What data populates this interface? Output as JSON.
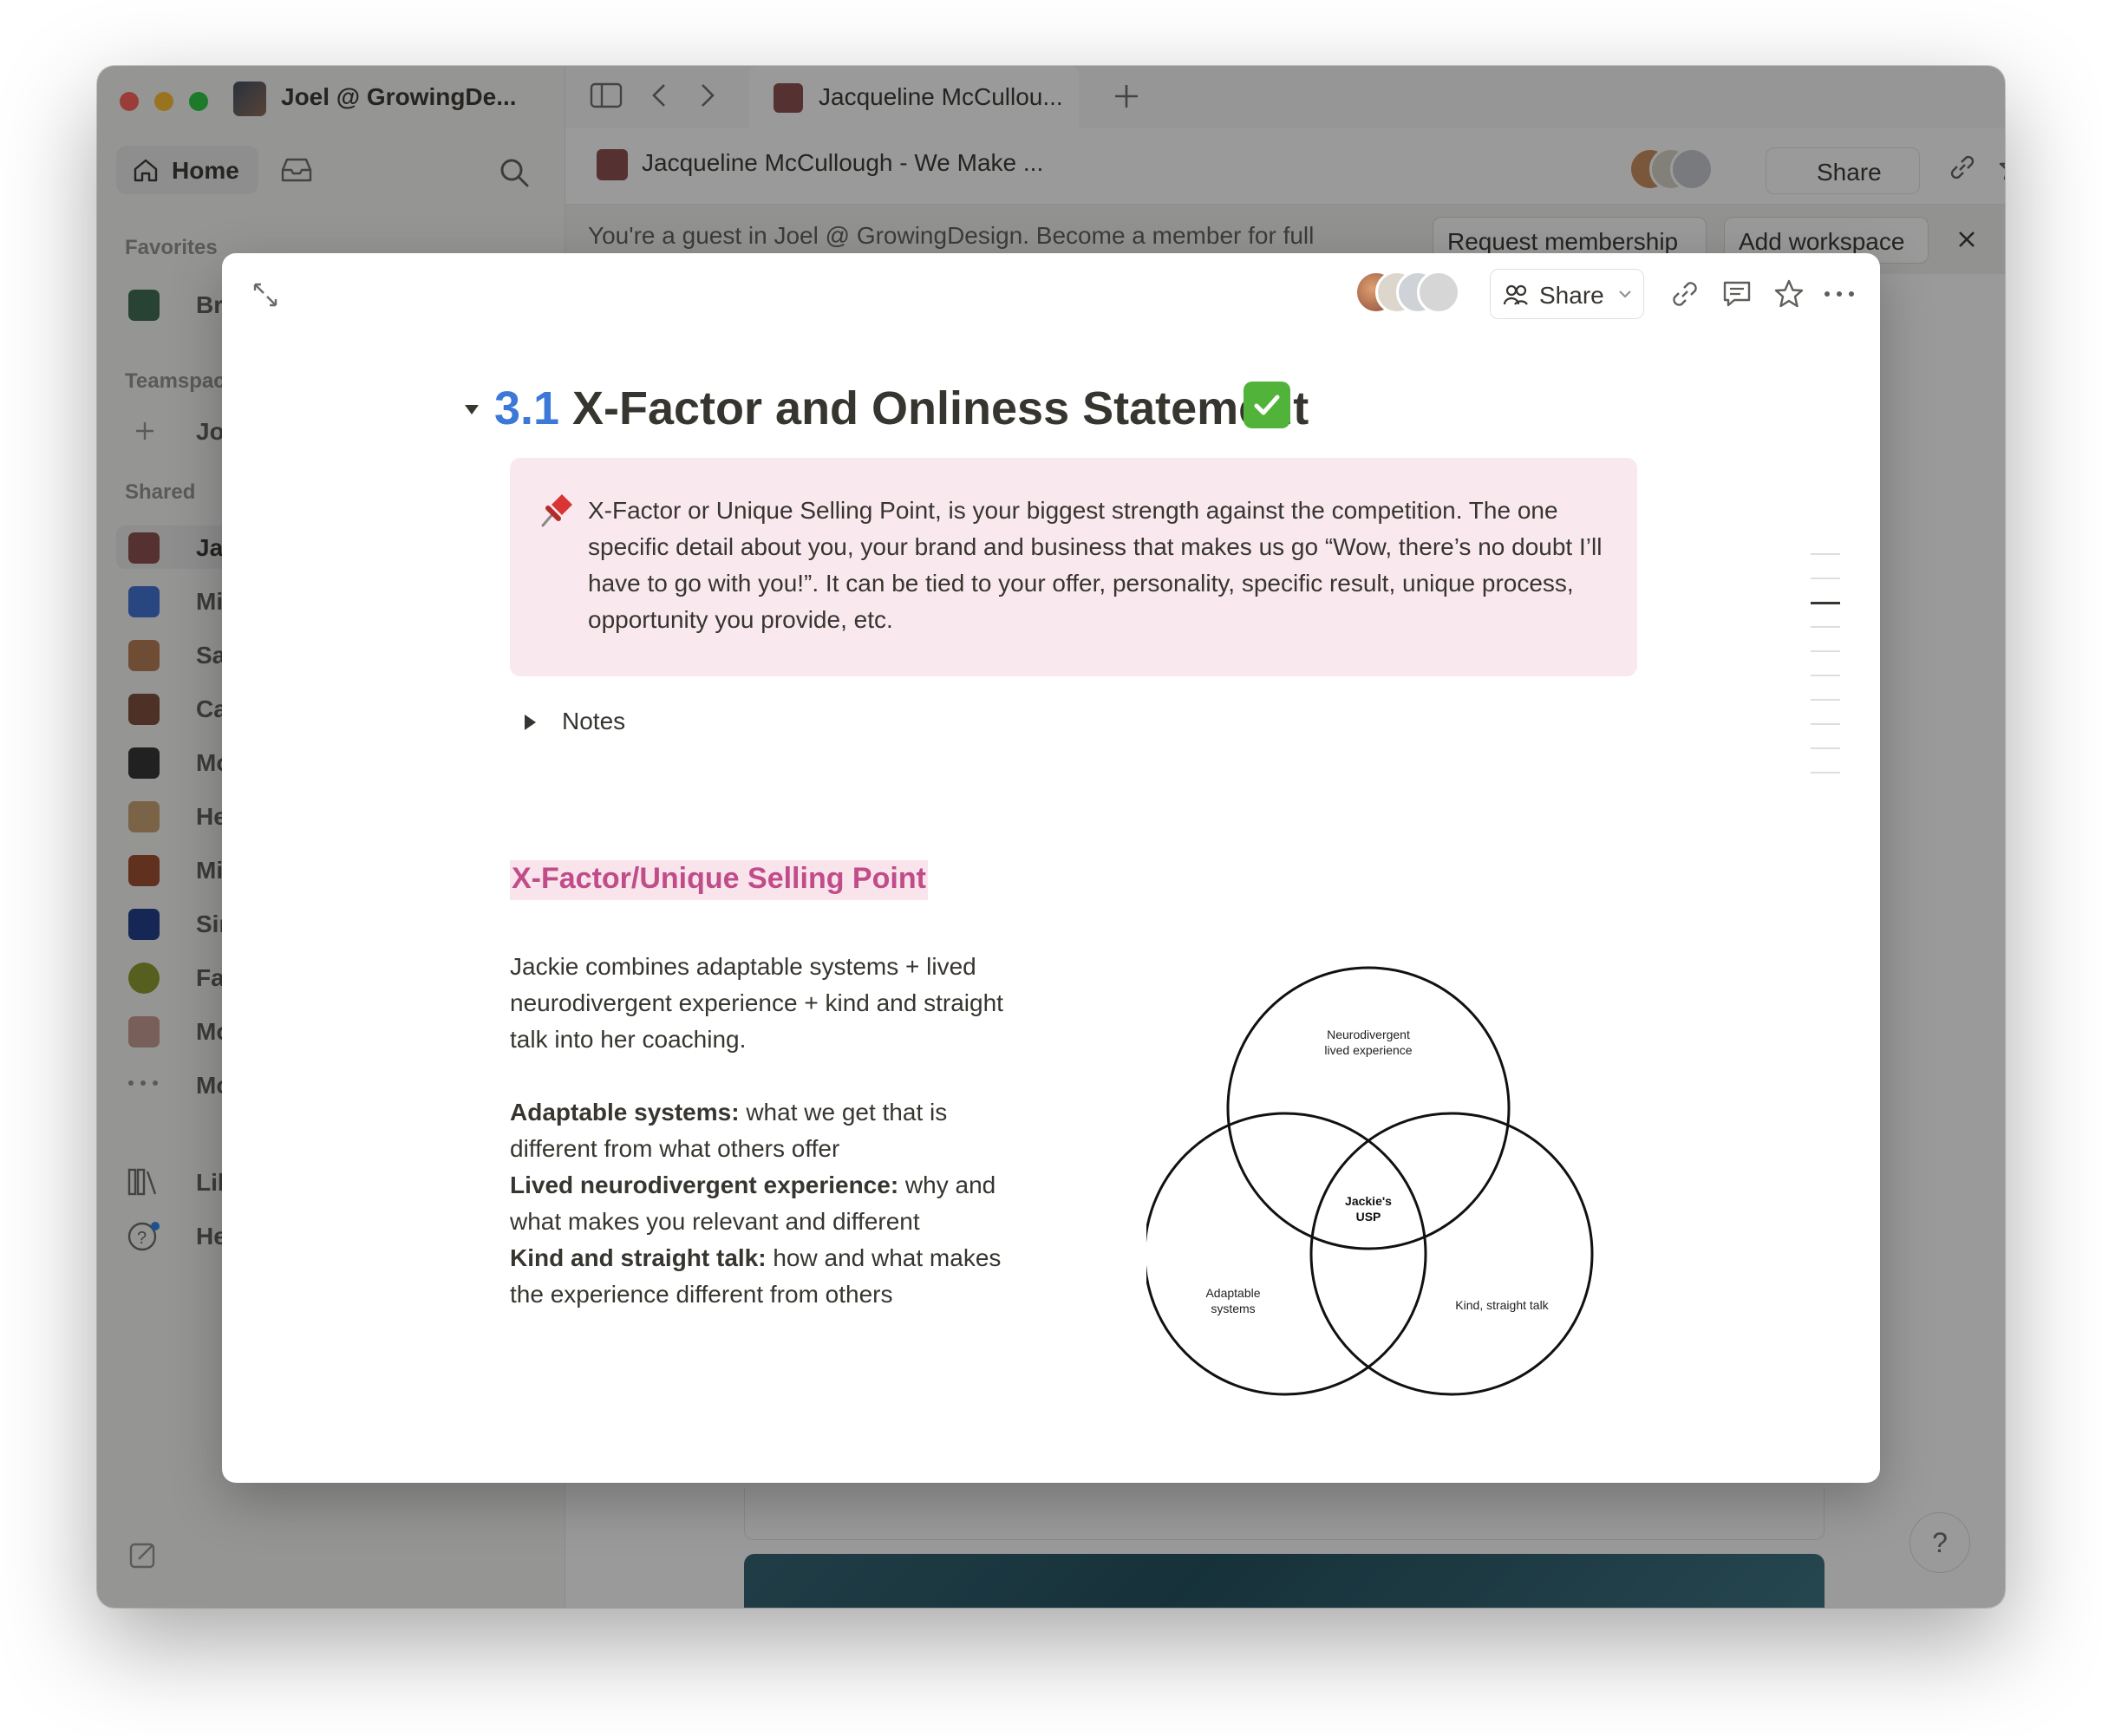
{
  "window": {
    "workspace_name": "Joel @ GrowingDe...",
    "tab_title": "Jacqueline McCullou...",
    "page_title": "Jacqueline McCullough - We Make ...",
    "share_label": "Share",
    "guest_banner": "You're a guest in Joel @ GrowingDesign. Become a member for full",
    "request_membership": "Request membership",
    "add_workspace": "Add workspace",
    "help": "?"
  },
  "sidebar": {
    "home_label": "Home",
    "favorites_label": "Favorites",
    "teamspaces_label": "Teamspac",
    "shared_label": "Shared",
    "favorites": [
      {
        "label": "Bru"
      }
    ],
    "join": "Join",
    "shared": [
      {
        "label": "Jac",
        "color": "#8a4a4a"
      },
      {
        "label": "Mia",
        "color": "#3b6fd1"
      },
      {
        "label": "San",
        "color": "#b57b52"
      },
      {
        "label": "Car",
        "color": "#7a4a3a"
      },
      {
        "label": "Mov",
        "color": "#2f2f2f"
      },
      {
        "label": "Hed",
        "color": "#c8a070"
      },
      {
        "label": "Mic",
        "color": "#9b4b2b"
      },
      {
        "label": "Sim",
        "color": "#1d3a8a"
      },
      {
        "label": "Faz",
        "color": "#8a9a2a"
      },
      {
        "label": "Mor",
        "color": "#c49a90"
      },
      {
        "label": "Mor",
        "color": "#999999"
      }
    ],
    "library": "Libr",
    "help": "Help"
  },
  "modal": {
    "share_label": "Share",
    "title_number": "3.1",
    "title_text": "X-Factor and Onliness Statement",
    "callout_text": "X-Factor or Unique Selling Point, is your biggest strength against the competition. The one specific detail about you, your brand and business that makes us go “Wow, there’s no doubt I’ll have to go with you!”. It can be tied to your offer, personality, specific result, unique process, opportunity you provide, etc.",
    "toggle_label": "Notes",
    "section_heading": "X-Factor/Unique Selling Point",
    "intro": "Jackie combines adaptable systems + lived neurodivergent experience + kind and straight talk into her coaching.",
    "points": [
      {
        "term": "Adaptable systems:",
        "desc": " what we get that is different from what others offer"
      },
      {
        "term": "Lived neurodivergent experience:",
        "desc": " why and what makes you relevant and different"
      },
      {
        "term": "Kind and straight talk:",
        "desc": " how and what makes the experience different from others"
      }
    ],
    "venn": {
      "top_line1": "Neurodivergent",
      "top_line2": "lived experience",
      "left_line1": "Adaptable",
      "left_line2": "systems",
      "right": "Kind, straight talk",
      "center_line1": "Jackie's",
      "center_line2": "USP"
    }
  },
  "colors": {
    "accent_blue": "#3c78d8",
    "callout_bg": "#f9e9ef",
    "heading_pink": "#c14c8a",
    "check_green": "#51b33a"
  }
}
